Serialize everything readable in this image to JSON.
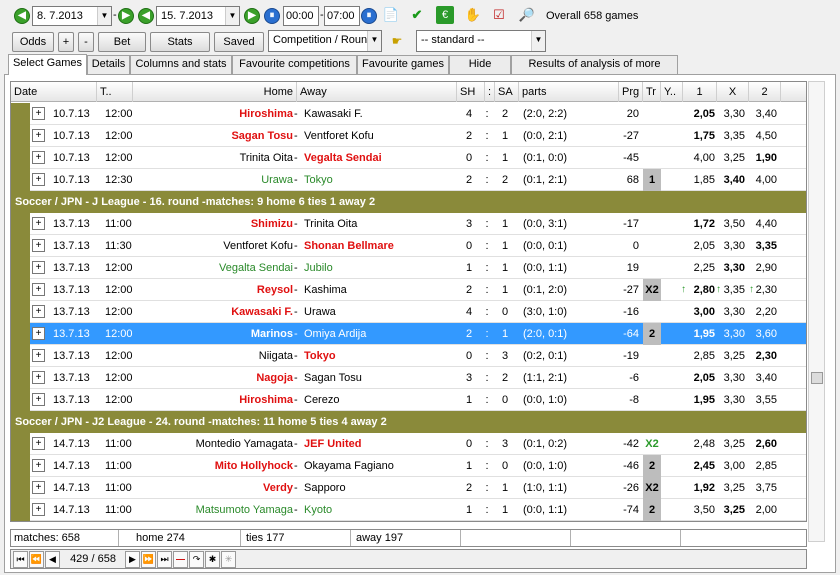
{
  "toolbar": {
    "date_from": "8.  7.2013",
    "date_to": "15.  7.2013",
    "time_from": "00:00",
    "time_to": "07:00",
    "overall": "Overall 658 games",
    "odds": "Odds",
    "plus": "+",
    "minus": "-",
    "bet": "Bet",
    "stats": "Stats",
    "saved": "Saved",
    "competition": "Competition / Roun",
    "standard": "-- standard --"
  },
  "tabs": [
    "Select Games",
    "Details",
    "Columns and stats",
    "Favourite competitions",
    "Favourite games",
    "Hide games",
    "Results of analysis of more filters"
  ],
  "columns": {
    "date": "Date",
    "t": "T..",
    "home": "Home",
    "away": "Away",
    "sh": "SH",
    "colon": ":",
    "sa": "SA",
    "parts": "parts",
    "prg": "Prg",
    "tr": "Tr",
    "y": "Y..",
    "o1": "1",
    "ox": "X",
    "o2": "2"
  },
  "rows": [
    {
      "kind": "match",
      "plus": "+",
      "date": "10.7.13",
      "time": "12:00",
      "home": "Hiroshima",
      "home_style": "red",
      "away": "Kawasaki F.",
      "away_style": "",
      "sh": "4",
      "sep": ":",
      "sa": "2",
      "parts": "(2:0, 2:2)",
      "prg": "20",
      "tr": "",
      "y": "",
      "o1": "2,05",
      "ox": "3,30",
      "o2": "3,40",
      "bold": "o1"
    },
    {
      "kind": "match",
      "plus": "+",
      "date": "10.7.13",
      "time": "12:00",
      "home": "Sagan Tosu",
      "home_style": "red",
      "away": "Ventforet Kofu",
      "away_style": "",
      "sh": "2",
      "sep": ":",
      "sa": "1",
      "parts": "(0:0, 2:1)",
      "prg": "-27",
      "tr": "",
      "y": "",
      "o1": "1,75",
      "ox": "3,35",
      "o2": "4,50",
      "bold": "o1"
    },
    {
      "kind": "match",
      "plus": "+",
      "date": "10.7.13",
      "time": "12:00",
      "home": "Trinita Oita",
      "home_style": "",
      "away": "Vegalta Sendai",
      "away_style": "red",
      "sh": "0",
      "sep": ":",
      "sa": "1",
      "parts": "(0:1, 0:0)",
      "prg": "-45",
      "tr": "",
      "y": "",
      "o1": "4,00",
      "ox": "3,25",
      "o2": "1,90",
      "bold": "o2"
    },
    {
      "kind": "match",
      "plus": "+",
      "date": "10.7.13",
      "time": "12:30",
      "home": "Urawa",
      "home_style": "green",
      "away": "Tokyo",
      "away_style": "green",
      "sh": "2",
      "sep": ":",
      "sa": "2",
      "parts": "(0:1, 2:1)",
      "prg": "68",
      "tr": "1",
      "y": "",
      "o1": "1,85",
      "ox": "3,40",
      "o2": "4,00",
      "bold": "ox"
    },
    {
      "kind": "group",
      "text": "Soccer / JPN - J League - 16. round -matches: 9  home 6  ties 1  away 2"
    },
    {
      "kind": "match",
      "plus": "+",
      "date": "13.7.13",
      "time": "11:00",
      "home": "Shimizu",
      "home_style": "red",
      "away": "Trinita Oita",
      "away_style": "",
      "sh": "3",
      "sep": ":",
      "sa": "1",
      "parts": "(0:0, 3:1)",
      "prg": "-17",
      "tr": "",
      "y": "",
      "o1": "1,72",
      "ox": "3,50",
      "o2": "4,40",
      "bold": "o1"
    },
    {
      "kind": "match",
      "plus": "+",
      "date": "13.7.13",
      "time": "11:30",
      "home": "Ventforet Kofu",
      "home_style": "",
      "away": "Shonan Bellmare",
      "away_style": "red",
      "sh": "0",
      "sep": ":",
      "sa": "1",
      "parts": "(0:0, 0:1)",
      "prg": "0",
      "tr": "",
      "y": "",
      "o1": "2,05",
      "ox": "3,30",
      "o2": "3,35",
      "bold": "o2"
    },
    {
      "kind": "match",
      "plus": "+",
      "date": "13.7.13",
      "time": "12:00",
      "home": "Vegalta Sendai",
      "home_style": "green",
      "away": "Jubilo",
      "away_style": "green",
      "sh": "1",
      "sep": ":",
      "sa": "1",
      "parts": "(0:0, 1:1)",
      "prg": "19",
      "tr": "",
      "y": "",
      "o1": "2,25",
      "ox": "3,30",
      "o2": "2,90",
      "bold": "ox"
    },
    {
      "kind": "match",
      "plus": "+",
      "date": "13.7.13",
      "time": "12:00",
      "home": "Reysol",
      "home_style": "red",
      "away": "Kashima",
      "away_style": "",
      "sh": "2",
      "sep": ":",
      "sa": "1",
      "parts": "(0:1, 2:0)",
      "prg": "-27",
      "tr": "X2",
      "y": "",
      "o1": "2,80",
      "ox": "3,35",
      "o2": "2,30",
      "bold": "o1",
      "arrows": true
    },
    {
      "kind": "match",
      "plus": "+",
      "date": "13.7.13",
      "time": "12:00",
      "home": "Kawasaki F.",
      "home_style": "red",
      "away": "Urawa",
      "away_style": "",
      "sh": "4",
      "sep": ":",
      "sa": "0",
      "parts": "(3:0, 1:0)",
      "prg": "-16",
      "tr": "",
      "y": "",
      "o1": "3,00",
      "ox": "3,30",
      "o2": "2,20",
      "bold": "o1"
    },
    {
      "kind": "match",
      "plus": "+",
      "date": "13.7.13",
      "time": "12:00",
      "home": "Marinos",
      "home_style": "bold",
      "away": "Omiya Ardija",
      "away_style": "",
      "sh": "2",
      "sep": ":",
      "sa": "1",
      "parts": "(2:0, 0:1)",
      "prg": "-64",
      "tr": "2",
      "y": "",
      "o1": "1,95",
      "ox": "3,30",
      "o2": "3,60",
      "bold": "o1",
      "selected": true
    },
    {
      "kind": "match",
      "plus": "+",
      "date": "13.7.13",
      "time": "12:00",
      "home": "Niigata",
      "home_style": "",
      "away": "Tokyo",
      "away_style": "red",
      "sh": "0",
      "sep": ":",
      "sa": "3",
      "parts": "(0:2, 0:1)",
      "prg": "-19",
      "tr": "",
      "y": "",
      "o1": "2,85",
      "ox": "3,25",
      "o2": "2,30",
      "bold": "o2"
    },
    {
      "kind": "match",
      "plus": "+",
      "date": "13.7.13",
      "time": "12:00",
      "home": "Nagoja",
      "home_style": "red",
      "away": "Sagan Tosu",
      "away_style": "",
      "sh": "3",
      "sep": ":",
      "sa": "2",
      "parts": "(1:1, 2:1)",
      "prg": "-6",
      "tr": "",
      "y": "",
      "o1": "2,05",
      "ox": "3,30",
      "o2": "3,40",
      "bold": "o1"
    },
    {
      "kind": "match",
      "plus": "+",
      "date": "13.7.13",
      "time": "12:00",
      "home": "Hiroshima",
      "home_style": "red",
      "away": "Cerezo",
      "away_style": "",
      "sh": "1",
      "sep": ":",
      "sa": "0",
      "parts": "(0:0, 1:0)",
      "prg": "-8",
      "tr": "",
      "y": "",
      "o1": "1,95",
      "ox": "3,30",
      "o2": "3,55",
      "bold": "o1"
    },
    {
      "kind": "group",
      "text": "Soccer / JPN - J2 League - 24. round -matches: 11  home 5  ties 4  away 2"
    },
    {
      "kind": "match",
      "plus": "+",
      "date": "14.7.13",
      "time": "11:00",
      "home": "Montedio Yamagata",
      "home_style": "",
      "away": "JEF United",
      "away_style": "red",
      "sh": "0",
      "sep": ":",
      "sa": "3",
      "parts": "(0:1, 0:2)",
      "prg": "-42",
      "tr": "X2",
      "y": "",
      "o1": "2,48",
      "ox": "3,25",
      "o2": "2,60",
      "bold": "o2",
      "tr_green": true
    },
    {
      "kind": "match",
      "plus": "+",
      "date": "14.7.13",
      "time": "11:00",
      "home": "Mito Hollyhock",
      "home_style": "red",
      "away": "Okayama Fagiano",
      "away_style": "",
      "sh": "1",
      "sep": ":",
      "sa": "0",
      "parts": "(0:0, 1:0)",
      "prg": "-46",
      "tr": "2",
      "y": "",
      "o1": "2,45",
      "ox": "3,00",
      "o2": "2,85",
      "bold": "o1"
    },
    {
      "kind": "match",
      "plus": "+",
      "date": "14.7.13",
      "time": "11:00",
      "home": "Verdy",
      "home_style": "red",
      "away": "Sapporo",
      "away_style": "",
      "sh": "2",
      "sep": ":",
      "sa": "1",
      "parts": "(1:0, 1:1)",
      "prg": "-26",
      "tr": "X2",
      "y": "",
      "o1": "1,92",
      "ox": "3,25",
      "o2": "3,75",
      "bold": "o1"
    },
    {
      "kind": "match",
      "plus": "+",
      "date": "14.7.13",
      "time": "11:00",
      "home": "Matsumoto Yamaga",
      "home_style": "green",
      "away": "Kyoto",
      "away_style": "green",
      "sh": "1",
      "sep": ":",
      "sa": "1",
      "parts": "(0:0, 1:1)",
      "prg": "-74",
      "tr": "2",
      "y": "",
      "o1": "3,50",
      "ox": "3,25",
      "o2": "2,00",
      "bold": "ox"
    }
  ],
  "status": {
    "matches": "matches: 658",
    "home": "home 274",
    "ties": "ties 177",
    "away": "away 197"
  },
  "nav": {
    "position": "429 / 658"
  },
  "colors": {
    "group_bar": "#8a8a3a",
    "selected": "#3399ff",
    "home_win": "#e01010",
    "draw": "#2a8a2a"
  }
}
